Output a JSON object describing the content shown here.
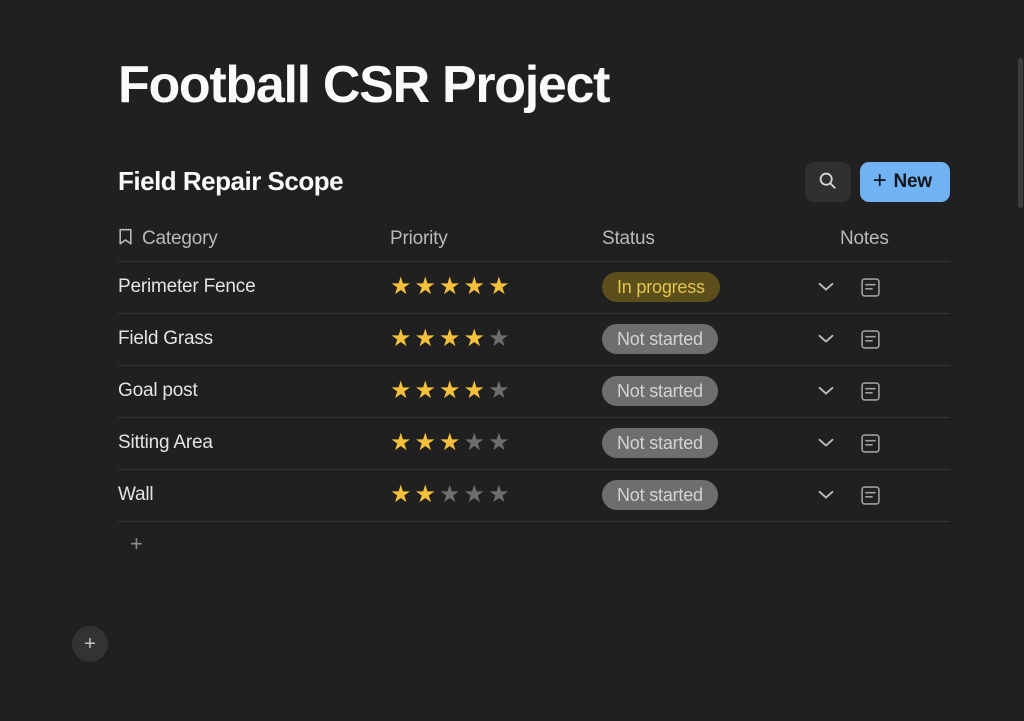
{
  "page": {
    "title": "Football CSR Project",
    "background_color": "#202020"
  },
  "database": {
    "title": "Field Repair Scope",
    "search_button": {
      "icon": "search-icon",
      "label": ""
    },
    "new_button": {
      "label": "New",
      "plus": "+",
      "color": "#71b2f2"
    },
    "columns": [
      {
        "label": "Category",
        "icon": "bookmark-icon"
      },
      {
        "label": "Priority",
        "icon": ""
      },
      {
        "label": "Status",
        "icon": ""
      },
      {
        "label": "Notes",
        "icon": ""
      }
    ],
    "rows": [
      {
        "category": "Perimeter Fence",
        "priority": 5,
        "priority_max": 5,
        "status": "In progress",
        "status_kind": "progress",
        "chevron": "chevron-down-icon",
        "note": "note-icon"
      },
      {
        "category": "Field Grass",
        "priority": 4,
        "priority_max": 5,
        "status": "Not started",
        "status_kind": "notstarted",
        "chevron": "chevron-down-icon",
        "note": "note-icon"
      },
      {
        "category": "Goal post",
        "priority": 4,
        "priority_max": 5,
        "status": "Not started",
        "status_kind": "notstarted",
        "chevron": "chevron-down-icon",
        "note": "note-icon"
      },
      {
        "category": "Sitting Area",
        "priority": 3,
        "priority_max": 5,
        "status": "Not started",
        "status_kind": "notstarted",
        "chevron": "chevron-down-icon",
        "note": "note-icon"
      },
      {
        "category": "Wall",
        "priority": 2,
        "priority_max": 5,
        "status": "Not started",
        "status_kind": "notstarted",
        "chevron": "chevron-down-icon",
        "note": "note-icon"
      }
    ],
    "add_row_label": "+",
    "status_colors": {
      "in_progress_bg": "#5c4f1b",
      "in_progress_text": "#e3c54b",
      "not_started_bg": "#6e6e6e",
      "not_started_text": "#d3d3d3"
    },
    "star_colors": {
      "filled": "#f5c13d",
      "empty": "#6e6e6e"
    }
  },
  "floating_add_button": {
    "label": "+"
  }
}
